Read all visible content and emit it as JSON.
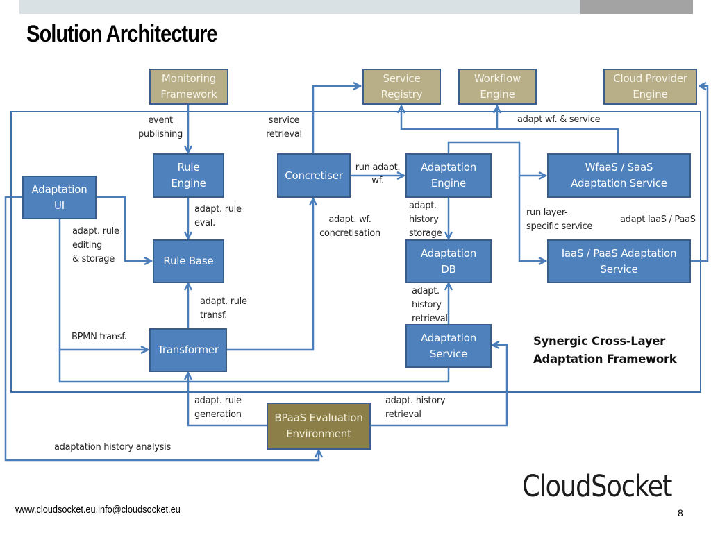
{
  "slide": {
    "title": "Solution Architecture",
    "footer_contact": "www.cloudsocket.eu,info@cloudsocket.eu",
    "logo_text": "CloudSocket",
    "page_number": "8"
  },
  "colors": {
    "component_fill": "#4f81bd",
    "external_fill": "#b8ae87",
    "evaluation_fill": "#8c7f47",
    "connector": "#4a7ebb"
  },
  "diagram": {
    "framework_label": "Synergic Cross-Layer\nAdaptation Framework",
    "external_components": {
      "monitoring_framework": "Monitoring\nFramework",
      "service_registry": "Service\nRegistry",
      "workflow_engine": "Workflow\nEngine",
      "cloud_provider_engine": "Cloud Provider\nEngine",
      "bpaas_evaluation_environment": "BPaaS Evaluation\nEnvironment"
    },
    "components": {
      "adaptation_ui": "Adaptation\nUI",
      "rule_engine": "Rule\nEngine",
      "rule_base": "Rule Base",
      "transformer": "Transformer",
      "concretiser": "Concretiser",
      "adaptation_engine": "Adaptation\nEngine",
      "adaptation_db": "Adaptation\nDB",
      "adaptation_service": "Adaptation\nService",
      "wfaas_saas_service": "WfaaS  / SaaS\nAdaptation Service",
      "iaas_paas_service": "IaaS / PaaS Adaptation\nService"
    },
    "edge_labels": {
      "event_publishing": "event\npublishing",
      "service_retrieval": "service\nretrieval",
      "adapt_wf_service": "adapt wf. & service",
      "run_adapt_wf": "run adapt.\nwf.",
      "adapt_rule_eval": "adapt. rule\neval.",
      "adapt_rule_editing": "adapt. rule\nediting\n& storage",
      "adapt_wf_concretisation": "adapt. wf.\nconcretisation",
      "adapt_history_storage": "adapt.\nhistory\nstorage",
      "run_layer_specific": "run layer-\nspecific service",
      "adapt_iaas_paas": "adapt IaaS / PaaS",
      "adapt_rule_transf": "adapt. rule\ntransf.",
      "adapt_history_retrieval_db": "adapt.\nhistory\nretrieval",
      "bpmn_transf": "BPMN transf.",
      "adapt_rule_generation": "adapt. rule\ngeneration",
      "adapt_history_retrieval_eval": "adapt. history\nretrieval",
      "adaptation_history_analysis": "adaptation history analysis"
    }
  }
}
